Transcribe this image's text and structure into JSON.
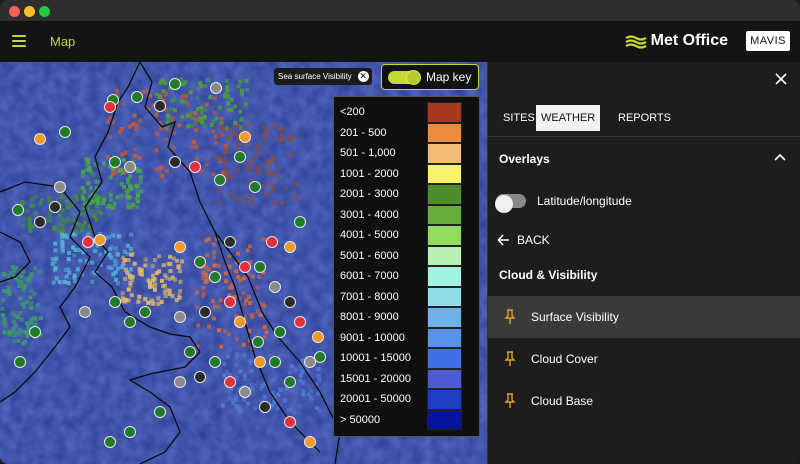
{
  "app": {
    "title": "Map",
    "brand": "Met Office",
    "badge": "MAVIS"
  },
  "map": {
    "chip": {
      "label": "Sea surface Visibility"
    },
    "map_key": {
      "label": "Map key",
      "on": true
    }
  },
  "legend": {
    "items": [
      {
        "label": "<200",
        "color": "#a9391e"
      },
      {
        "label": "201 - 500",
        "color": "#ec8a3e"
      },
      {
        "label": "501 - 1,000",
        "color": "#f5bb75"
      },
      {
        "label": "1001 - 2000",
        "color": "#f7f36a"
      },
      {
        "label": "2001 - 3000",
        "color": "#4c8d2c"
      },
      {
        "label": "3001 - 4000",
        "color": "#67ad3e"
      },
      {
        "label": "4001 - 5000",
        "color": "#91dc5c"
      },
      {
        "label": "5001 - 6000",
        "color": "#b9f0b1"
      },
      {
        "label": "6001 - 7000",
        "color": "#9ef3e2"
      },
      {
        "label": "7001 - 8000",
        "color": "#8fdde8"
      },
      {
        "label": "8001 - 9000",
        "color": "#6fb1e9"
      },
      {
        "label": "9001 - 10000",
        "color": "#5793e9"
      },
      {
        "label": "10001 - 15000",
        "color": "#3f70e6"
      },
      {
        "label": "15001 - 20000",
        "color": "#4b5bd6"
      },
      {
        "label": "20001 - 50000",
        "color": "#1c3fc4"
      },
      {
        "label": "> 50000",
        "color": "#05149a"
      }
    ]
  },
  "panel": {
    "tabs": [
      {
        "label": "SITES",
        "active": false
      },
      {
        "label": "WEATHER",
        "active": true
      },
      {
        "label": "REPORTS",
        "active": false
      }
    ],
    "overlays": {
      "title": "Overlays"
    },
    "latlon": {
      "label": "Latitude/longitude",
      "on": false
    },
    "back": {
      "label": "BACK"
    },
    "cloud_visibility": {
      "title": "Cloud & Visibility",
      "items": [
        {
          "label": "Surface Visibility",
          "highlighted": true
        },
        {
          "label": "Cloud Cover",
          "highlighted": false
        },
        {
          "label": "Cloud Base",
          "highlighted": false
        }
      ]
    }
  },
  "colors": {
    "accent": "#c4d936",
    "pin": "#e0a030"
  }
}
